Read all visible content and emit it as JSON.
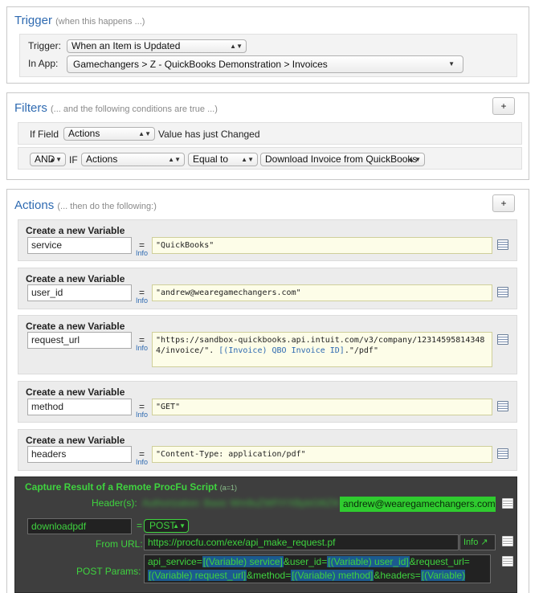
{
  "trigger": {
    "title": "Trigger",
    "subtitle": "(when this happens ...)",
    "trigger_label": "Trigger:",
    "trigger_value": "When an Item is Updated",
    "app_label": "In App:",
    "app_value": "Gamechangers > Z - QuickBooks Demonstration > Invoices"
  },
  "filters": {
    "title": "Filters",
    "subtitle": "(... and the following conditions are true ...)",
    "add_label": "+",
    "row1": {
      "if_label": "If Field",
      "field": "Actions",
      "suffix": "Value has just Changed"
    },
    "row2": {
      "conj": "AND",
      "if_label": "IF",
      "field": "Actions",
      "op": "Equal to",
      "value": "Download Invoice from QuickBooks"
    }
  },
  "actions": {
    "title": "Actions",
    "subtitle": "(... then do the following:)",
    "add_label": "+",
    "eq": "=",
    "info": "Info",
    "items": [
      {
        "title": "Create a new Variable",
        "name": "service",
        "value": "\"QuickBooks\""
      },
      {
        "title": "Create a new Variable",
        "name": "user_id",
        "value": "\"andrew@wearegamechangers.com\""
      },
      {
        "title": "Create a new Variable",
        "name": "request_url",
        "value_line1": "\"https://sandbox-quickbooks.api.intuit.com/v3/company/123145958143484/invoice/\".",
        "value_line2_link": "[(Invoice) QBO Invoice ID]",
        "value_line2_rest": ".\"/pdf\""
      },
      {
        "title": "Create a new Variable",
        "name": "method",
        "value": "\"GET\""
      },
      {
        "title": "Create a new Variable",
        "name": "headers",
        "value": "\"Content-Type: application/pdf\""
      }
    ]
  },
  "procfu": {
    "title": "Capture Result of a Remote ProcFu Script",
    "counter": "(a=1)",
    "headers_label": "Header(s):",
    "headers_blurred": "Authorization: Basic Wm9uZWFtYXBpbGl6ZWRfdG9r",
    "email": "andrew@wearegamechangers.com",
    "var_name": "downloadpdf",
    "method": "POST",
    "url_label": "From URL:",
    "url": "https://procfu.com/exe/api_make_request.pf",
    "info_label": "Info ↗",
    "post_label": "POST Params:",
    "post_parts": {
      "p1": "api_service=",
      "c1": "[(Variable) service]",
      "p2": "&user_id=",
      "c2": "[(Variable) user_id]",
      "p3": "&request_url=",
      "c3": "[(Variable) request_url]",
      "p4": "&method=",
      "c4": "[(Variable) method]",
      "p5": "&headers=",
      "c5": "[(Variable) headers]"
    }
  }
}
